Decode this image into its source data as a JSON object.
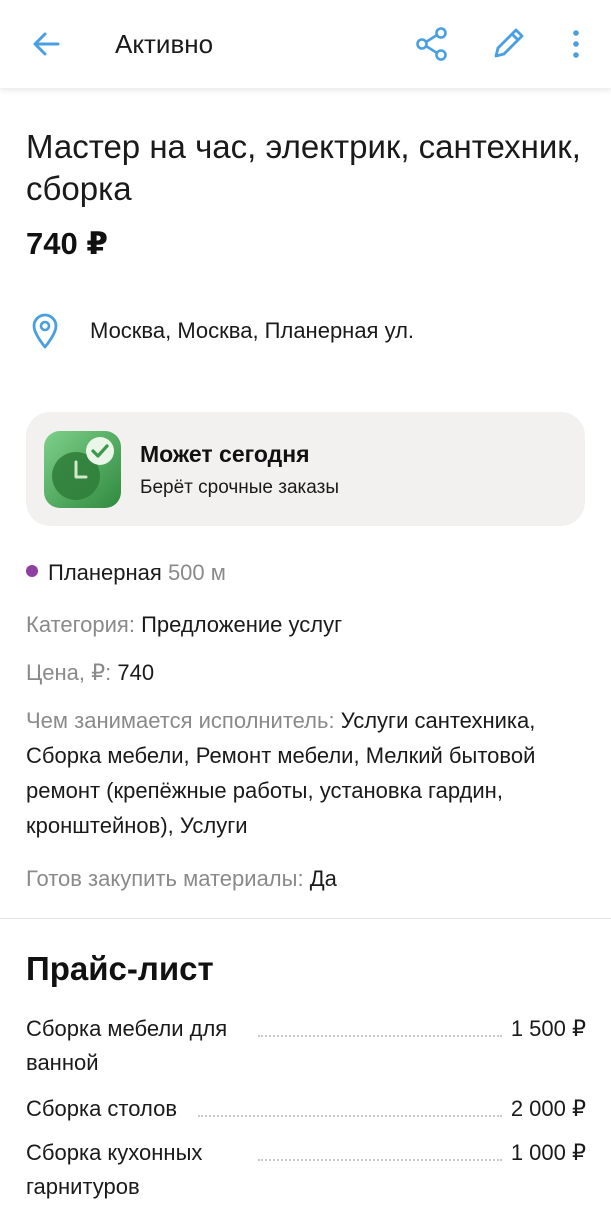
{
  "header": {
    "title": "Активно",
    "icons": [
      "back-arrow-icon",
      "share-icon",
      "edit-pencil-icon",
      "more-vertical-icon"
    ],
    "accent_color": "#4a9fe0"
  },
  "listing": {
    "title": "Мастер на час, электрик, сантехник, сборка",
    "price": "740 ₽",
    "location": "Москва, Москва, Планерная ул."
  },
  "availability_card": {
    "title": "Может сегодня",
    "subtitle": "Берёт срочные заказы",
    "icon": "clock-check-icon",
    "icon_color": "#3a9a4a"
  },
  "metro": {
    "station": "Планерная",
    "distance": "500 м",
    "line_color": "#8e3fa0"
  },
  "details": [
    {
      "label": "Категория:",
      "value": " Предложение услуг"
    },
    {
      "label": "Цена, ₽:",
      "value": " 740"
    },
    {
      "label": "Чем занимается исполнитель:",
      "value": " Услуги сантехника, Сборка мебели, Ремонт мебели, Мелкий бытовой ремонт (крепёжные работы, установка гардин, кронштейнов), Услуги"
    },
    {
      "label": "Готов закупить материалы:",
      "value": " Да"
    }
  ],
  "price_list": {
    "title": "Прайс-лист",
    "items": [
      {
        "name": "Сборка мебели для ванной",
        "price": "1 500 ₽"
      },
      {
        "name": "Сборка столов",
        "price": "2 000 ₽"
      },
      {
        "name": "Сборка кухонных гарнитуров",
        "price": "1 000 ₽"
      }
    ]
  }
}
